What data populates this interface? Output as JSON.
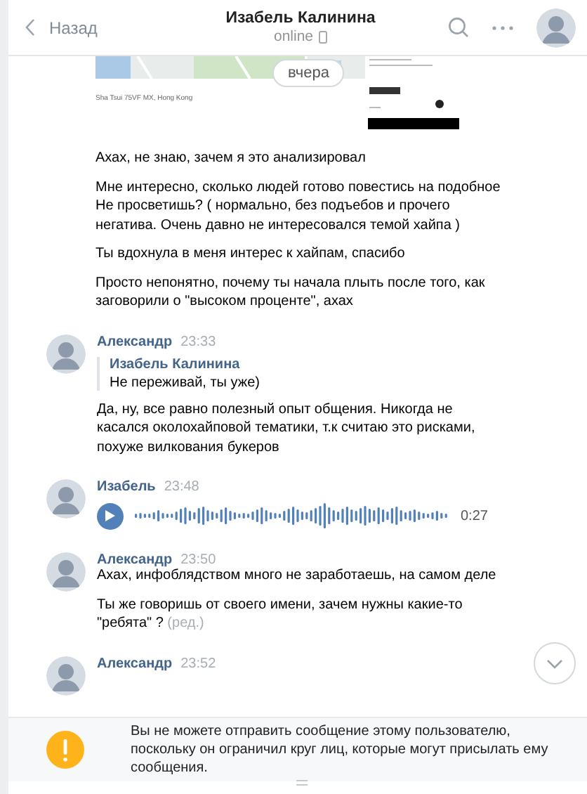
{
  "header": {
    "back": "Назад",
    "title": "Изабель Калинина",
    "status": "online"
  },
  "attachments": {
    "map_caption": "Sha Tsui 75VF MX, Hong Kong",
    "date_pill": "вчера"
  },
  "messages": [
    {
      "kind": "continuation",
      "paragraphs": [
        "Ахах, не знаю, зачем я это анализировал",
        "Мне интересно, сколько людей готово повестись на подобное\nНе просветишь? ( нормально, без подъебов и прочего негатива. Очень давно не интересовался темой хайпа )",
        "Ты вдохнула в меня интерес к хайпам, спасибо",
        "Просто непонятно, почему ты начала плыть после того, как заговорили о \"высоком проценте\", ахах"
      ]
    },
    {
      "kind": "reply",
      "author": "Александр",
      "time": "23:33",
      "quote": {
        "author": "Изабель Калинина",
        "text": "Не переживай, ты уже)"
      },
      "paragraphs": [
        "Да, ну, все равно полезный опыт общения. Никогда не касался околохайповой тематики, т.к считаю это рисками, похуже вилкования букеров"
      ]
    },
    {
      "kind": "voice",
      "author": "Изабель",
      "time": "23:48",
      "duration": "0:27"
    },
    {
      "kind": "text",
      "author": "Александр",
      "time": "23:50",
      "paragraphs": [
        "Ахах, инфоблядством много не заработаешь, на самом деле",
        "Ты же говоришь от своего имени, зачем нужны какие-то \"ребята\" ?"
      ],
      "edited": "(ред.)"
    },
    {
      "kind": "header_only",
      "author": "Александр",
      "time": "23:52"
    }
  ],
  "notice": "Вы не можете отправить сообщение этому пользователю, поскольку он ограничил круг лиц, которые могут присылать ему сообщения."
}
